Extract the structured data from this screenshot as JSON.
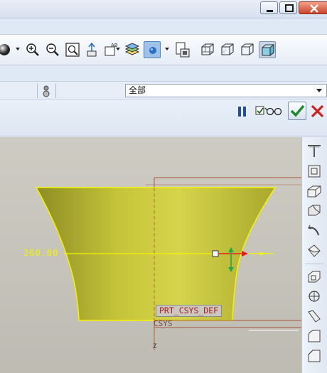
{
  "filter": {
    "selected": "全部"
  },
  "viewport": {
    "dimension_value": "360.00",
    "csys_label": "PRT_CSYS_DEF",
    "csys_sub_label": "CSYS",
    "z_axis_label": "Z"
  },
  "colors": {
    "model_fill": "#c9c83c",
    "model_edge": "#f4f400",
    "accent_active": "#9fc3e8",
    "ok_green": "#1f8a2b",
    "cancel_red": "#d21f1f",
    "datum_red": "#b01818"
  },
  "icons": {
    "toolbar": [
      "shaded-sphere-icon",
      "zoom-in-icon",
      "zoom-out-icon",
      "refit-icon",
      "reorient-icon",
      "named-view-icon",
      "layers-icon",
      "display-style-icon",
      "view-manager-icon",
      "wireframe-icon",
      "hidden-line-icon",
      "no-hidden-icon",
      "shading-icon"
    ],
    "sidebar": [
      "datum-plane-icon",
      "datum-axis-icon",
      "sketch-icon",
      "extrude-icon",
      "revolve-icon",
      "sweep-icon",
      "datum-point-icon",
      "csys-icon",
      "rib-icon",
      "round-icon",
      "chamfer-icon"
    ]
  }
}
